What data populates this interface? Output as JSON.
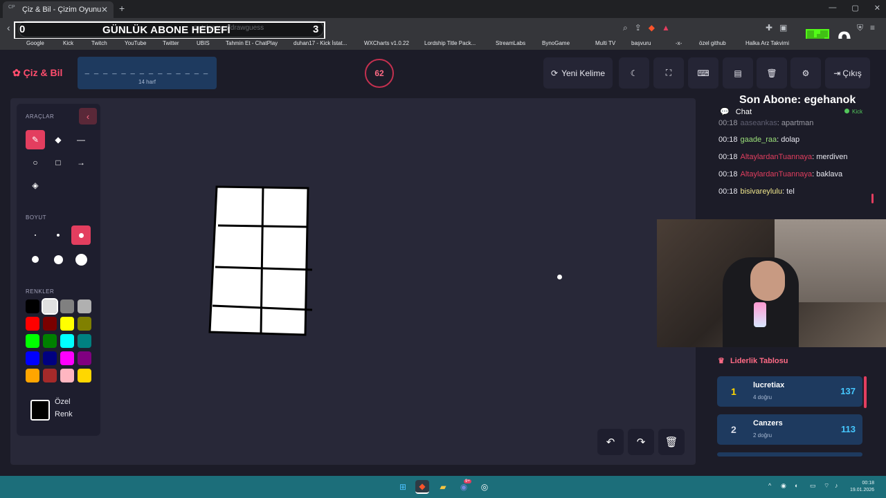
{
  "browser": {
    "tab_title": "Çiz & Bil - Çizim Oyunu",
    "tab_favicon_text": "CP",
    "url": "m.tr/games/drawguess",
    "win_minimize": "—",
    "win_maximize": "▢",
    "win_close": "✕"
  },
  "overlay": {
    "goal_current": "0",
    "goal_title": "GÜNLÜK ABONE HEDEFİ",
    "goal_target": "3",
    "viewer_count": "9",
    "last_sub": "Son Abone: egehanok"
  },
  "bookmarks": [
    "Google",
    "Kick",
    "Twitch",
    "YouTube",
    "Twitter",
    "UBIS",
    "Tahmin Et - ChatPlay",
    "duhan17 - Kick İstat...",
    "WXCharts v1.0.22",
    "Lordship Title Pack...",
    "StreamLabs",
    "BynoGame",
    "Multi TV",
    "başvuru",
    "-x-",
    "özel github",
    "Halka Arz Takvimi"
  ],
  "app": {
    "brand": "Çiz & Bil",
    "word_mask": "_ _ _ _ _ _ _ _ _ _ _ _ _ _",
    "word_length": "14 harf",
    "timer": "62",
    "new_word_label": "Yeni Kelime",
    "logout_label": "Çıkış"
  },
  "tools": {
    "section_tools": "ARAÇLAR",
    "section_size": "BOYUT",
    "section_colors": "RENKLER",
    "custom_color_line1": "Özel",
    "custom_color_line2": "Renk",
    "colors": [
      "#000000",
      "#e0e0e0",
      "#808080",
      "#b0b0b0",
      "#ff0000",
      "#7a0000",
      "#ffff00",
      "#808000",
      "#00ff00",
      "#008000",
      "#00ffff",
      "#008080",
      "#0000ff",
      "#000080",
      "#ff00ff",
      "#800080",
      "#ffa500",
      "#a52a2a",
      "#ffb6c1",
      "#ffd700"
    ]
  },
  "chat": {
    "title": "Chat",
    "platform": "Kick",
    "messages": [
      {
        "time": "00:18",
        "user": "aaseankas",
        "text": ": apartman",
        "color": "#8a8aa0"
      },
      {
        "time": "00:18",
        "user": "gaade_raa",
        "text": ": dolap",
        "color": "#9be07a"
      },
      {
        "time": "00:18",
        "user": "AltaylardanTuannaya",
        "text": ": merdiven",
        "color": "#e33e5f"
      },
      {
        "time": "00:18",
        "user": "AltaylardanTuannaya",
        "text": ": baklava",
        "color": "#e33e5f"
      },
      {
        "time": "00:18",
        "user": "bisivareylulu",
        "text": ": tel",
        "color": "#f0e68c"
      }
    ]
  },
  "leaderboard": {
    "title": "Liderlik Tablosu",
    "rows": [
      {
        "rank": "1",
        "name": "lucretiax",
        "sub": "4 doğru",
        "score": "137",
        "rank_color": "#ffd700"
      },
      {
        "rank": "2",
        "name": "Canzers",
        "sub": "2 doğru",
        "score": "113",
        "rank_color": "#d8dce8"
      }
    ]
  },
  "taskbar": {
    "time": "00:18",
    "date": "19.01.2026",
    "notif_badge": "9+"
  }
}
